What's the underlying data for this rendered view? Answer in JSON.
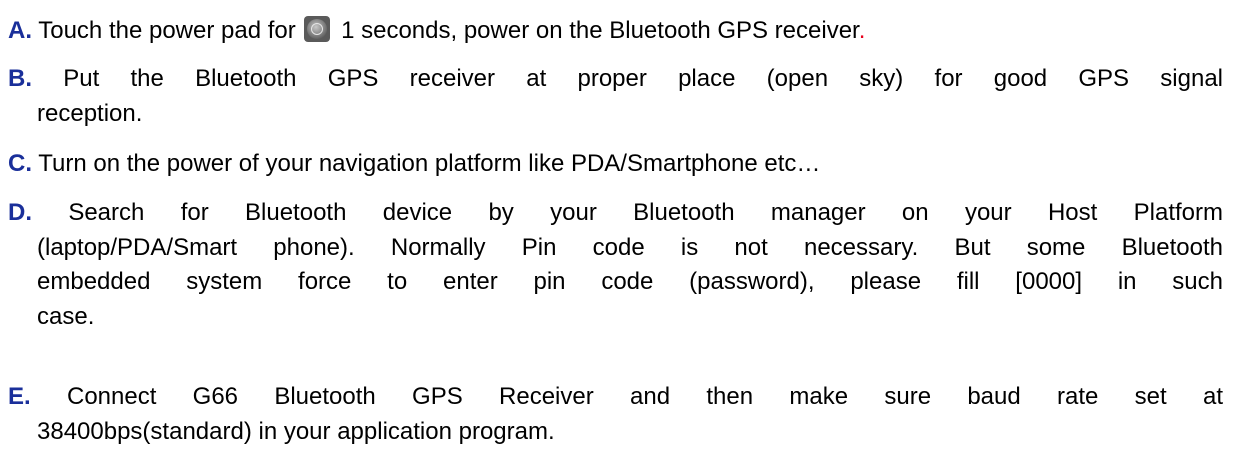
{
  "step_a": {
    "letter": "A.",
    "before_icon": " Touch the power pad for ",
    "after_icon": " 1 seconds, power on the Bluetooth GPS receiver",
    "period": "."
  },
  "step_b": {
    "letter": "B.",
    "line1": " Put the Bluetooth GPS receiver at proper place (open sky) for good GPS signal",
    "line2": "reception."
  },
  "step_c": {
    "letter": "C.",
    "text": " Turn on the power of your navigation platform like PDA/Smartphone etc…"
  },
  "step_d": {
    "letter": "D.",
    "line1": " Search for Bluetooth device by your Bluetooth manager on your Host Platform",
    "line2": "(laptop/PDA/Smart phone). Normally Pin code is not necessary. But some Bluetooth",
    "line3": "embedded system force to enter pin code (password), please fill [0000] in such",
    "line4": "case."
  },
  "step_e": {
    "letter": "E.",
    "line1": " Connect G66 Bluetooth GPS Receiver and then make sure baud rate set at",
    "line2": "38400bps(standard) in your application program."
  },
  "colors": {
    "step_letter": "#1a2f9a",
    "accent_period": "#e8001c",
    "body_text": "#000000"
  },
  "icons": {
    "power_pad": "power-pad-icon"
  }
}
